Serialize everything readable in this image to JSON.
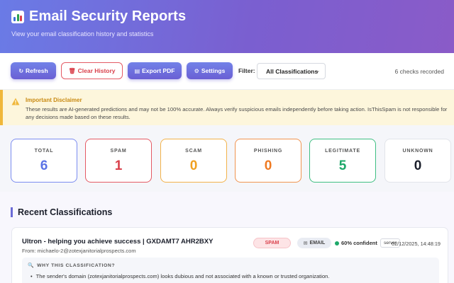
{
  "header": {
    "title": "Email Security Reports",
    "subtitle": "View your email classification history and statistics",
    "icon": "bar-chart-icon"
  },
  "toolbar": {
    "refresh_label": "Refresh",
    "clear_label": "Clear History",
    "export_label": "Export PDF",
    "settings_label": "Settings",
    "filter_label": "Filter:",
    "filter_value": "All Classifications",
    "count_text": "6 checks recorded"
  },
  "disclaimer": {
    "title": "Important Disclaimer",
    "text": "These results are AI-generated predictions and may not be 100% accurate. Always verify suspicious emails independently before taking action. IsThisSpam is not responsible for any decisions made based on these results."
  },
  "stats": [
    {
      "label": "TOTAL",
      "value": "6",
      "color": "#5b73e6",
      "border": "#7b8cf0"
    },
    {
      "label": "SPAM",
      "value": "1",
      "color": "#d9404b",
      "border": "#e45a64"
    },
    {
      "label": "SCAM",
      "value": "0",
      "color": "#f0a020",
      "border": "#f2b24a"
    },
    {
      "label": "PHISHING",
      "value": "0",
      "color": "#ef7a22",
      "border": "#f09450"
    },
    {
      "label": "LEGITIMATE",
      "value": "5",
      "color": "#1ea86a",
      "border": "#3fbf82"
    },
    {
      "label": "UNKNOWN",
      "value": "0",
      "color": "#1b1f2b",
      "border": "#e2e4ea"
    }
  ],
  "recent": {
    "heading": "Recent Classifications",
    "items": [
      {
        "subject": "Ultron - helping you achieve success | GXDAMT7 AHR2BXY",
        "from": "From: michaelo-2@zotexjanitorialprospects.com",
        "tag": "SPAM",
        "type": "EMAIL",
        "confidence": "60% confident",
        "source": "server",
        "timestamp": "02/12/2025, 14:48:19",
        "why_title": "WHY THIS CLASSIFICATION?",
        "reason": "The sender's domain (zotexjanitorialprospects.com) looks dubious and not associated with a known or trusted organization."
      }
    ]
  }
}
